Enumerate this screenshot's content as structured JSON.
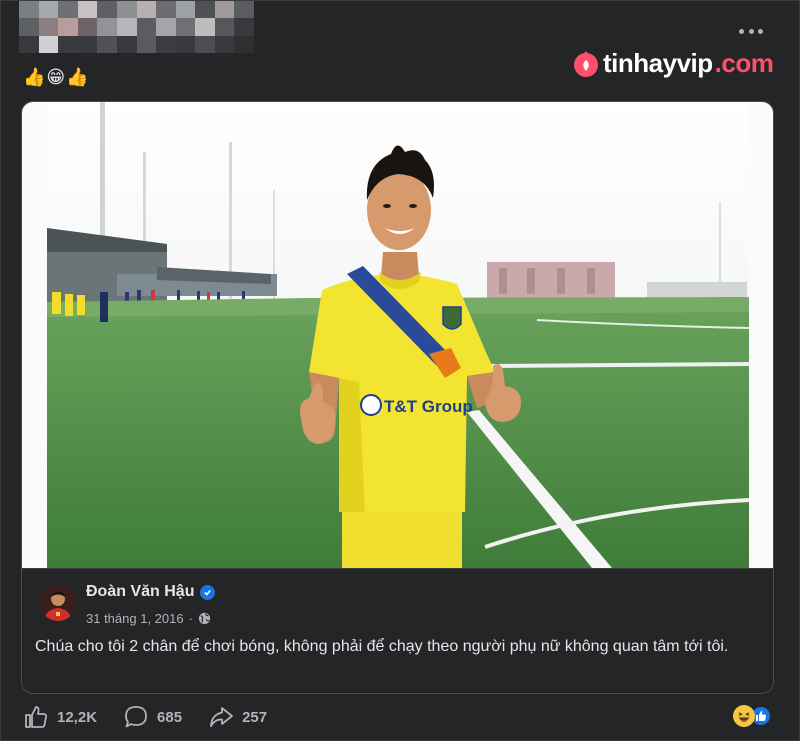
{
  "post": {
    "emoji_text": "👍😁👍",
    "watermark": {
      "brand": "tinhayvip",
      "suffix": ".com"
    }
  },
  "shared": {
    "author": "Đoàn Văn Hậu",
    "date": "31 tháng 1, 2016",
    "separator": "·",
    "text": "Chúa cho tôi 2 chân để chơi bóng, không phải để chạy theo người phụ nữ không quan tâm tới tôi.",
    "jersey_text": "T&T Group"
  },
  "stats": {
    "likes": "12,2K",
    "comments": "685",
    "shares": "257"
  },
  "colors": {
    "background": "#242526",
    "text": "#e4e6eb",
    "muted": "#b0b3b8",
    "accent_blue": "#1b74e4",
    "watermark_pink": "#ff4f6d",
    "jersey_yellow": "#f3e431",
    "pitch_green": "#4f8b45"
  },
  "icons": [
    "more-icon",
    "verified-icon",
    "globe-icon",
    "like-icon",
    "comment-icon",
    "share-icon",
    "haha-reaction-icon",
    "like-reaction-icon"
  ]
}
